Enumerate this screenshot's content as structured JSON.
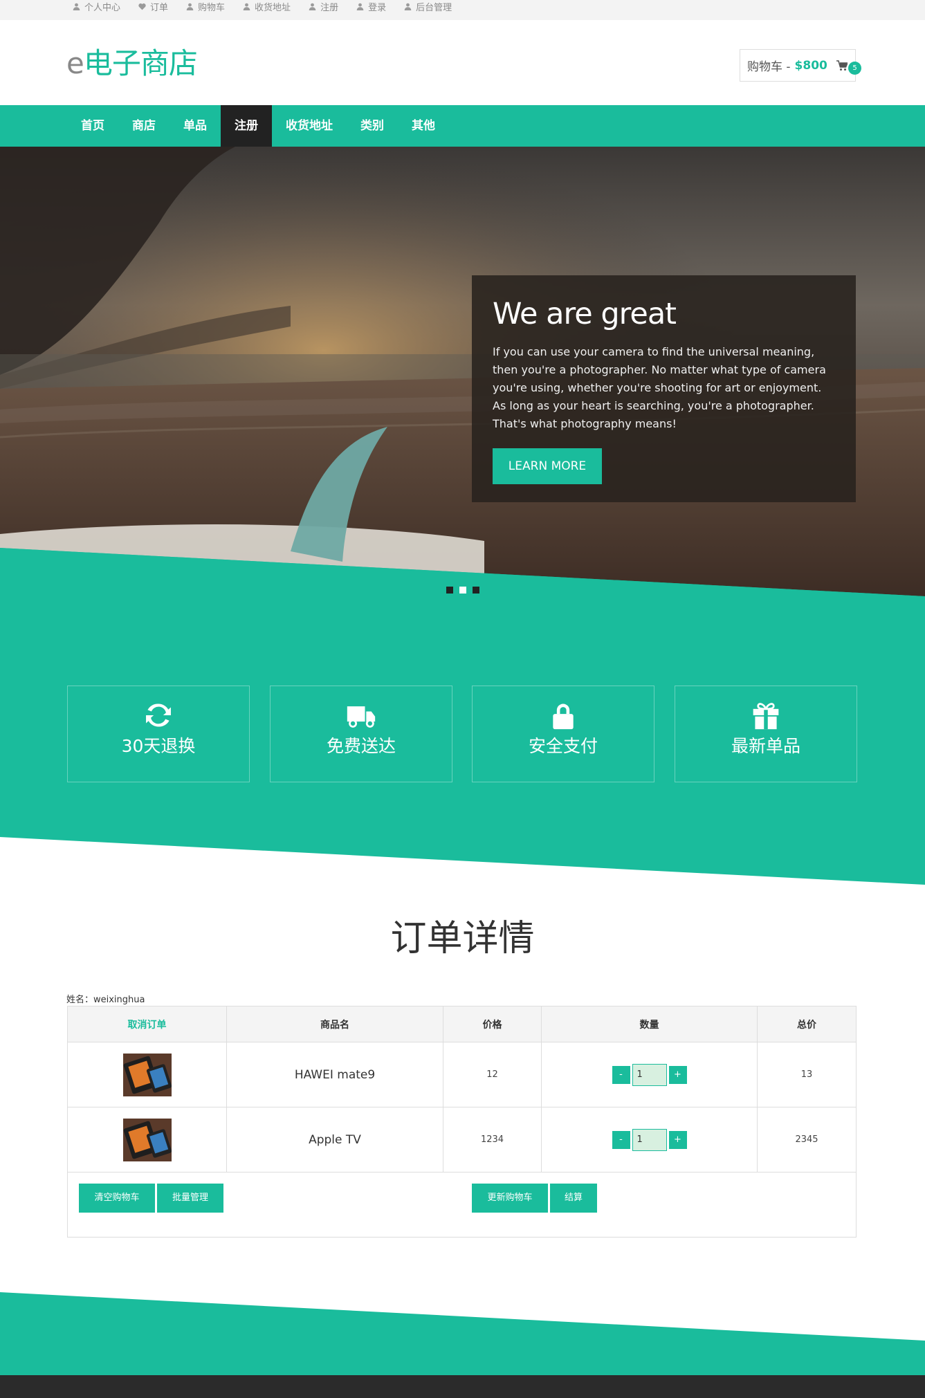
{
  "topbar": {
    "items": [
      {
        "label": "个人中心",
        "icon": "user-icon"
      },
      {
        "label": "订单",
        "icon": "heart-icon"
      },
      {
        "label": "购物车",
        "icon": "user-icon"
      },
      {
        "label": "收货地址",
        "icon": "user-icon"
      },
      {
        "label": "注册",
        "icon": "user-icon"
      },
      {
        "label": "登录",
        "icon": "user-icon"
      },
      {
        "label": "后台管理",
        "icon": "user-icon"
      }
    ]
  },
  "header": {
    "logo_prefix": "e",
    "logo_main": "电子商店",
    "cart_label": "购物车 -",
    "cart_amount": "$800",
    "cart_count": "5"
  },
  "nav": {
    "items": [
      "首页",
      "商店",
      "单品",
      "注册",
      "收货地址",
      "类别",
      "其他"
    ],
    "active": "注册"
  },
  "hero": {
    "title": "We are great",
    "text": "If you can use your camera to find the universal meaning, then you're a photographer. No matter what type of camera you're using, whether you're shooting for art or enjoyment. As long as your heart is searching, you're a photographer. That's what photography means!",
    "button": "LEARN MORE",
    "active_slide": 2
  },
  "features": [
    {
      "label": "30天退换",
      "icon": "refresh-icon"
    },
    {
      "label": "免费送达",
      "icon": "truck-icon"
    },
    {
      "label": "安全支付",
      "icon": "lock-icon"
    },
    {
      "label": "最新单品",
      "icon": "gift-icon"
    }
  ],
  "order": {
    "title": "订单详情",
    "username": "姓名：weixinghua",
    "headers": [
      "取消订单",
      "商品名",
      "价格",
      "数量",
      "总价"
    ],
    "rows": [
      {
        "name": "HAWEI mate9",
        "price": "12",
        "qty": "1",
        "total": "13"
      },
      {
        "name": "Apple TV",
        "price": "1234",
        "qty": "1",
        "total": "2345"
      }
    ],
    "buttons": {
      "clear": "清空购物车",
      "batch": "批量管理",
      "update": "更新购物车",
      "checkout": "结算"
    },
    "minus": "-",
    "plus": "+"
  },
  "colors": {
    "accent": "#1abc9c",
    "dark": "#222222"
  }
}
